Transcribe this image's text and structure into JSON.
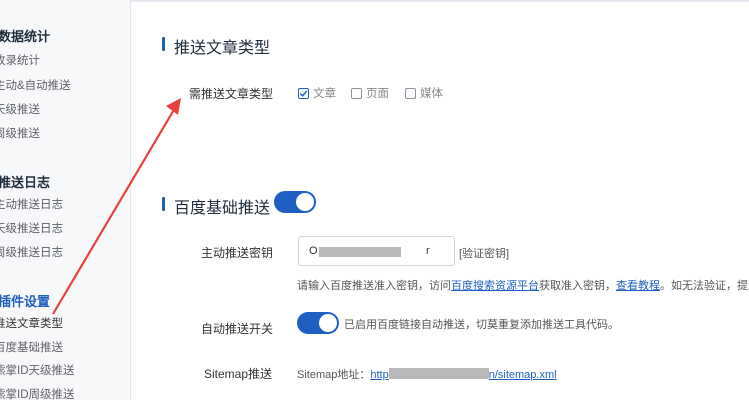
{
  "sidebar": {
    "groups": [
      {
        "title": "数据统计",
        "items": [
          "收录统计",
          "手动&自动推送",
          "天级推送",
          "周级推送"
        ]
      },
      {
        "title": "推送日志",
        "items": [
          "手动推送日志",
          "天级推送日志",
          "周级推送日志"
        ]
      },
      {
        "title": "插件设置",
        "items": [
          "推送文章类型",
          "百度基础推送",
          "熊掌ID天级推送",
          "熊掌ID周级推送"
        ]
      }
    ],
    "visible": {
      "g0": "数据统计",
      "g0i0": "收录统计",
      "g0i1": "主动&自动推送",
      "g0i2": "天级推送",
      "g0i3": "周级推送",
      "g1": "推送日志",
      "g1i0": "主动推送日志",
      "g1i1": "天级推送日志",
      "g1i2": "周级推送日志",
      "g2": "插件设置",
      "g2i0": "推送文章类型",
      "g2i1": "百度基础推送",
      "g2i2": "熊掌ID天级推送",
      "g2i3": "熊掌ID周级推送"
    }
  },
  "post_types_section": {
    "title": "推送文章类型",
    "field_label": "需推送文章类型",
    "options": [
      {
        "label": "文章",
        "checked": true
      },
      {
        "label": "页面",
        "checked": false
      },
      {
        "label": "媒体",
        "checked": false
      }
    ]
  },
  "baidu_section": {
    "title": "百度基础推送",
    "enabled": true,
    "key_label": "主动推送密钥",
    "key_prefix": "O",
    "key_suffix": "r",
    "verify_link": "[验证密钥]",
    "hint_1": "请输入百度推送准入密钥，访问",
    "hint_link_1": "百度搜索资源平台",
    "hint_2": "获取准入密钥，",
    "hint_link_2": "查看教程",
    "hint_3": "。如无法验证，提示site s",
    "auto_label": "自动推送开关",
    "auto_enabled": true,
    "auto_desc": "已启用百度链接自动推送，切莫重复添加推送工具代码。",
    "sitemap_label": "Sitemap推送",
    "sitemap_prefix": "Sitemap地址：",
    "sitemap_link_start": "http",
    "sitemap_link_end": "n/sitemap.xml"
  },
  "annotation": {
    "color": "#e8423f"
  },
  "colors": {
    "accent": "#1f5fc2",
    "sidebar_bg": "#f7f8fa"
  }
}
